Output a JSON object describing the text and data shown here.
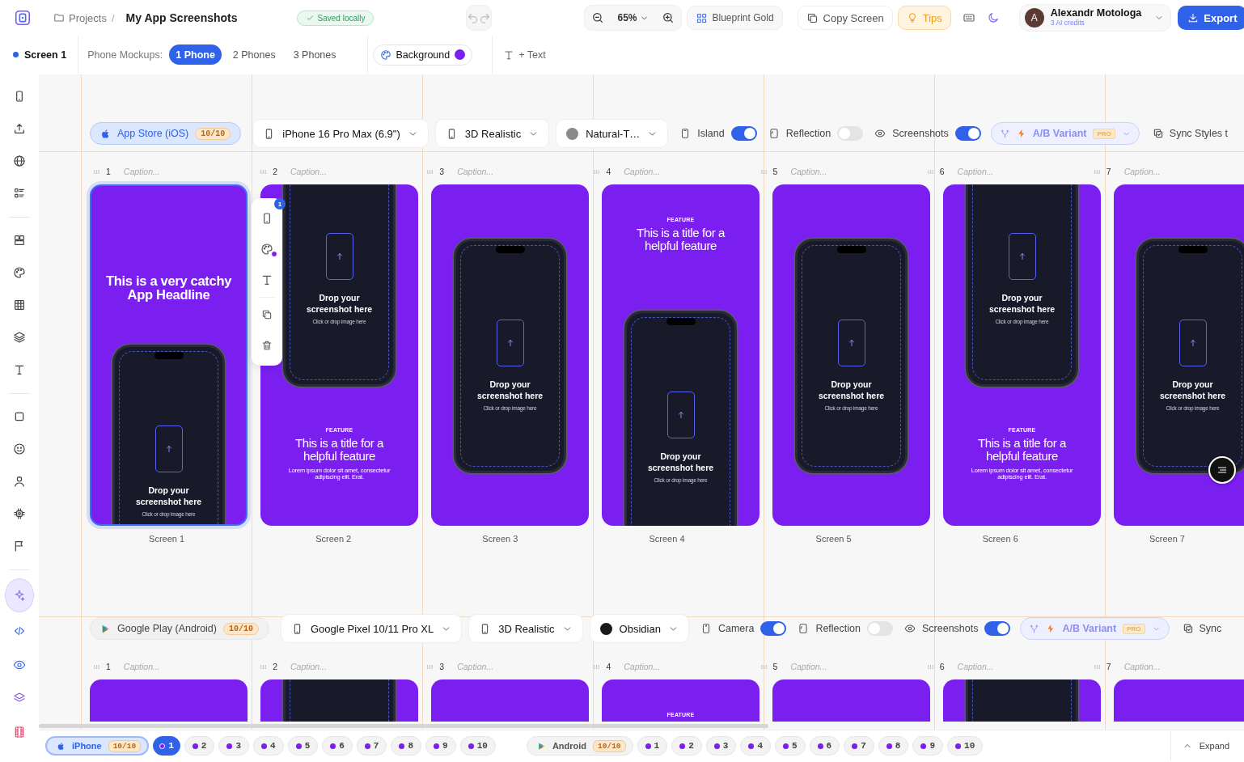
{
  "app": {
    "breadcrumb": "Projects",
    "separator": "/",
    "title": "My App Screenshots",
    "save_status": "Saved locally"
  },
  "top_toolbar": {
    "zoom": "65%",
    "theme_button": "Blueprint Gold",
    "copy_button": "Copy Screen",
    "tips_button": "Tips",
    "user": {
      "initial": "A",
      "name": "Alexandr Motologa",
      "credits": "3 AI credits"
    },
    "export_button": "Export"
  },
  "screen_bar": {
    "current_screen": "Screen 1",
    "mockups_label": "Phone Mockups:",
    "mockup_tabs": [
      {
        "label": "1 Phone",
        "selected": true
      },
      {
        "label": "2 Phones",
        "selected": false
      },
      {
        "label": "3 Phones",
        "selected": false
      }
    ],
    "background_button": "Background",
    "text_button": "+ Text"
  },
  "sidebar": {
    "groups": [
      {
        "items": [
          {
            "kind": "phone",
            "selected": false
          },
          {
            "kind": "upload",
            "selected": false
          },
          {
            "kind": "globe",
            "selected": false
          },
          {
            "kind": "list",
            "selected": false
          }
        ]
      },
      {
        "items": [
          {
            "kind": "layout",
            "selected": false
          },
          {
            "kind": "palette",
            "selected": false
          },
          {
            "kind": "grid",
            "selected": false
          },
          {
            "kind": "layers",
            "selected": false
          },
          {
            "kind": "text",
            "selected": false
          }
        ]
      },
      {
        "items": [
          {
            "kind": "square",
            "selected": false
          },
          {
            "kind": "smiley",
            "selected": false
          },
          {
            "kind": "user",
            "selected": false
          },
          {
            "kind": "chip",
            "selected": false
          },
          {
            "kind": "flag",
            "selected": false
          }
        ]
      },
      {
        "items": [
          {
            "kind": "sparkles",
            "selected": true
          },
          {
            "kind": "code",
            "selected": false
          },
          {
            "kind": "eye",
            "selected": false
          },
          {
            "kind": "stack",
            "selected": false
          },
          {
            "kind": "film",
            "selected": false
          }
        ]
      }
    ]
  },
  "selection_toolbar": {
    "badge": "1"
  },
  "stores": [
    {
      "kind": "ios",
      "store": "App Store (iOS)",
      "count": "10/10",
      "selected": true,
      "device": "iPhone 16 Pro Max (6.9\")",
      "style": "3D Realistic",
      "frame": "Natural-T…",
      "color": "#8a8a8a",
      "toggles": [
        {
          "kind": "island",
          "label": "Island",
          "on": true
        },
        {
          "kind": "reflection",
          "label": "Reflection",
          "on": false
        },
        {
          "kind": "screenshots",
          "label": "Screenshots",
          "on": true
        }
      ],
      "variant": {
        "label": "A/B Variant",
        "badge": "PRO"
      },
      "sync": "Sync Styles t",
      "screens": [
        {
          "number": "1",
          "caption_placeholder": "Caption...",
          "kind": "headline",
          "selected": true,
          "headline": "This is a very catchy App Headline",
          "drop_title": "Drop your screenshot here",
          "drop_hint": "Click or drop image here",
          "label": "Screen 1"
        },
        {
          "number": "2",
          "caption_placeholder": "Caption...",
          "kind": "phone-top",
          "selected": false,
          "drop_title": "Drop your screenshot here",
          "drop_hint": "Click or drop image here",
          "eyebrow": "FEATURE",
          "title": "This is a title for a helpful feature",
          "body": "Lorem ipsum dolor sit amet, consectetur adipiscing elit. Erat.",
          "label": "Screen 2"
        },
        {
          "number": "3",
          "caption_placeholder": "Caption...",
          "kind": "phone-center",
          "selected": false,
          "drop_title": "Drop your screenshot here",
          "drop_hint": "Click or drop image here",
          "label": "Screen 3"
        },
        {
          "number": "4",
          "caption_placeholder": "Caption...",
          "kind": "text-top",
          "selected": false,
          "eyebrow": "FEATURE",
          "title": "This is a title for a helpful feature",
          "drop_title": "Drop your screenshot here",
          "drop_hint": "Click or drop image here",
          "label": "Screen 4"
        },
        {
          "number": "5",
          "caption_placeholder": "Caption...",
          "kind": "phone-center",
          "selected": false,
          "drop_title": "Drop your screenshot here",
          "drop_hint": "Click or drop image here",
          "label": "Screen 5"
        },
        {
          "number": "6",
          "caption_placeholder": "Caption...",
          "kind": "phone-top",
          "selected": false,
          "drop_title": "Drop your screenshot here",
          "drop_hint": "Click or drop image here",
          "eyebrow": "FEATURE",
          "title": "This is a title for a helpful feature",
          "body": "Lorem ipsum dolor sit amet, consectetur adipiscing elit. Erat.",
          "label": "Screen 6"
        },
        {
          "number": "7",
          "caption_placeholder": "Caption...",
          "kind": "phone-center",
          "selected": false,
          "drop_title": "Drop your screenshot here",
          "drop_hint": "Click or drop image here",
          "label": "Screen 7"
        }
      ]
    },
    {
      "kind": "android",
      "store": "Google Play (Android)",
      "count": "10/10",
      "selected": false,
      "device": "Google Pixel 10/11 Pro XL",
      "style": "3D Realistic",
      "frame": "Obsidian",
      "color": "#1a1a1a",
      "toggles": [
        {
          "kind": "camera",
          "label": "Camera",
          "on": true
        },
        {
          "kind": "reflection",
          "label": "Reflection",
          "on": false
        },
        {
          "kind": "screenshots",
          "label": "Screenshots",
          "on": true
        }
      ],
      "variant": {
        "label": "A/B Variant",
        "badge": "PRO"
      },
      "sync": "Sync",
      "screens": [
        {
          "number": "1",
          "caption_placeholder": "Caption...",
          "kind": "plain",
          "selected": false
        },
        {
          "number": "2",
          "caption_placeholder": "Caption...",
          "kind": "phone-top",
          "selected": false
        },
        {
          "number": "3",
          "caption_placeholder": "Caption...",
          "kind": "plain",
          "selected": false
        },
        {
          "number": "4",
          "caption_placeholder": "Caption...",
          "kind": "text-top",
          "selected": false,
          "eyebrow": "FEATURE"
        },
        {
          "number": "5",
          "caption_placeholder": "Caption...",
          "kind": "plain",
          "selected": false
        },
        {
          "number": "6",
          "caption_placeholder": "Caption...",
          "kind": "phone-top",
          "selected": false
        },
        {
          "number": "7",
          "caption_placeholder": "Caption...",
          "kind": "plain",
          "selected": false
        }
      ]
    }
  ],
  "bottom_bar": {
    "groups": [
      {
        "kind": "ios",
        "label": "iPhone",
        "count": "10/10",
        "selected": true,
        "screens": [
          {
            "label": "1",
            "selected": true
          },
          {
            "label": "2",
            "selected": false
          },
          {
            "label": "3",
            "selected": false
          },
          {
            "label": "4",
            "selected": false
          },
          {
            "label": "5",
            "selected": false
          },
          {
            "label": "6",
            "selected": false
          },
          {
            "label": "7",
            "selected": false
          },
          {
            "label": "8",
            "selected": false
          },
          {
            "label": "9",
            "selected": false
          },
          {
            "label": "10",
            "selected": false
          }
        ]
      },
      {
        "kind": "android",
        "label": "Android",
        "count": "10/10",
        "selected": false,
        "screens": [
          {
            "label": "1",
            "selected": false
          },
          {
            "label": "2",
            "selected": false
          },
          {
            "label": "3",
            "selected": false
          },
          {
            "label": "4",
            "selected": false
          },
          {
            "label": "5",
            "selected": false
          },
          {
            "label": "6",
            "selected": false
          },
          {
            "label": "7",
            "selected": false
          },
          {
            "label": "8",
            "selected": false
          },
          {
            "label": "9",
            "selected": false
          },
          {
            "label": "10",
            "selected": false
          }
        ]
      }
    ],
    "expand_button": "Expand"
  }
}
